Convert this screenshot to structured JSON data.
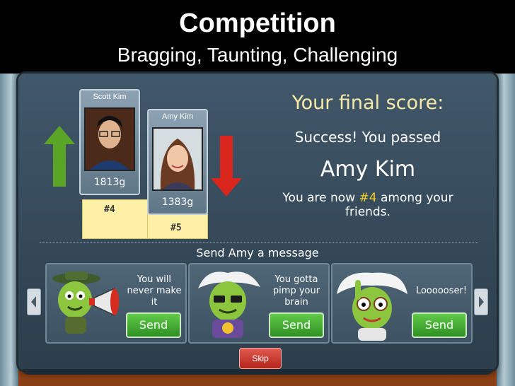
{
  "slide": {
    "title": "Competition",
    "subtitle": "Bragging, Taunting, Challenging"
  },
  "leaderboard": {
    "player1": {
      "name": "Scott Kim",
      "score": "1813g",
      "rank": "#4"
    },
    "player2": {
      "name": "Amy Kim",
      "score": "1383g",
      "rank": "#5"
    }
  },
  "results": {
    "heading": "Your final score:",
    "status": "Success! You passed",
    "passed_name": "Amy Kim",
    "rank_prefix": "You are now ",
    "rank_value": "#4",
    "rank_suffix": " among your",
    "rank_line2": "friends."
  },
  "messages": {
    "title": "Send Amy a message",
    "cards": [
      {
        "text": "You will never make it",
        "button": "Send"
      },
      {
        "text": "You gotta pimp your brain",
        "button": "Send"
      },
      {
        "text": "Loooooser!",
        "button": "Send"
      }
    ],
    "skip": "Skip"
  },
  "colors": {
    "send_green": "#3fae30",
    "skip_red": "#c8322a",
    "up_arrow": "#5aa528",
    "down_arrow": "#d8261c",
    "rank_highlight": "#f2d02e"
  },
  "icons": [
    "up-arrow-icon",
    "down-arrow-icon",
    "left-chevron-icon",
    "right-chevron-icon",
    "megaphone-icon"
  ]
}
